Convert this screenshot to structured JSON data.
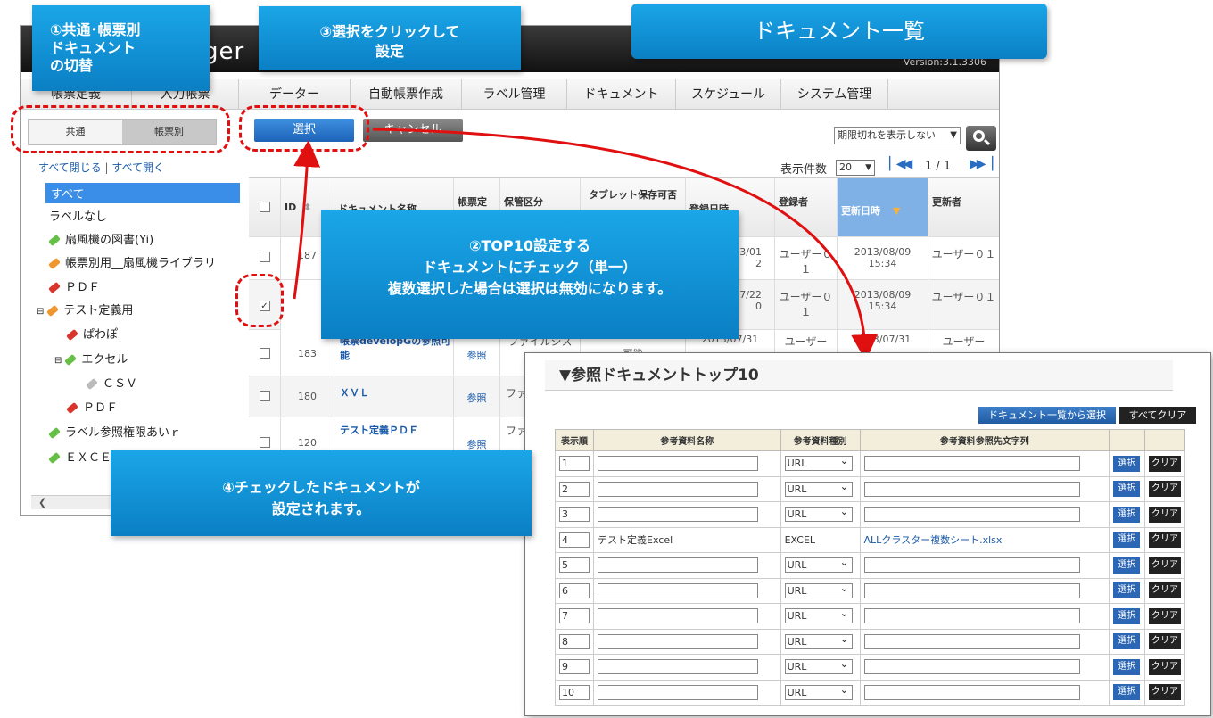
{
  "app": {
    "logo_text": "ger",
    "version": "Version:3.1.3306",
    "nav": [
      "帳票定義",
      "入力帳票",
      "データー",
      "自動帳票作成",
      "ラベル管理",
      "ドキュメント",
      "スケジュール",
      "システム管理"
    ],
    "segment": {
      "common": "共通",
      "form": "帳票別"
    },
    "tree_controls": {
      "close_all": "すべて閉じる",
      "sep": "|",
      "open_all": "すべて開く"
    },
    "tree": [
      {
        "label": "すべて",
        "tag": ""
      },
      {
        "label": "ラベルなし",
        "tag": ""
      },
      {
        "label": "扇風機の図書(Yi)",
        "tag": "green"
      },
      {
        "label": "帳票別用__扇風機ライブラリ",
        "tag": "orange"
      },
      {
        "label": "ＰＤＦ",
        "tag": "red"
      },
      {
        "label": "テスト定義用",
        "tag": "orange"
      },
      {
        "label": "ぱわぽ",
        "tag": "red"
      },
      {
        "label": "エクセル",
        "tag": "green"
      },
      {
        "label": "ＣＳＶ",
        "tag": "grey"
      },
      {
        "label": "ＰＤＦ",
        "tag": "red"
      },
      {
        "label": "ラベル参照権限あいｒ",
        "tag": "green"
      },
      {
        "label": "ＥＸＣＥ",
        "tag": "green"
      }
    ],
    "toolbar": {
      "select": "選択",
      "cancel": "キャンセル",
      "expire_filter": "期限切れを表示しない",
      "page_size_label": "表示件数",
      "page_size": "20",
      "page_info": "1 / 1"
    },
    "columns": [
      "ID",
      "ドキュメント名称",
      "帳票定",
      "保管区分",
      "タブレット保存可否",
      "登録日時",
      "登録者",
      "更新日時",
      "更新者"
    ],
    "rows": [
      {
        "id": "187",
        "name": "",
        "ref": "",
        "storage": "",
        "tablet": "",
        "reg_date": "3/01",
        "reg_time": "2",
        "registrant": "ユーザー０１",
        "upd_date": "2013/08/09",
        "upd_time": "15:34",
        "updater": "ユーザー０１",
        "checked": false
      },
      {
        "id": "",
        "name": "",
        "ref": "",
        "storage": "",
        "tablet": "",
        "reg_date": "7/22",
        "reg_time": "0",
        "registrant": "ユーザー０１",
        "upd_date": "2013/08/09",
        "upd_time": "15:34",
        "updater": "ユーザー０１",
        "checked": true
      },
      {
        "id": "183",
        "name": "帳票developGの参照可能",
        "ref": "参照",
        "storage": "ファイルシス",
        "tablet": "可能",
        "reg_date": "2013/07/31",
        "reg_time": "",
        "registrant": "ユーザー",
        "upd_date": "2013/07/31",
        "upd_time": "",
        "updater": "ユーザー",
        "checked": false
      },
      {
        "id": "180",
        "name": "ＸＶＬ",
        "ref": "参照",
        "storage": "ファ",
        "tablet": "",
        "reg_date": "",
        "reg_time": "",
        "registrant": "",
        "upd_date": "",
        "upd_time": "",
        "updater": "",
        "checked": false
      },
      {
        "id": "120",
        "name": "テスト定義ＰＤＦ",
        "ref": "参照",
        "storage": "ファ",
        "tablet": "",
        "reg_date": "",
        "reg_time": "",
        "registrant": "",
        "upd_date": "",
        "upd_time": "",
        "updater": "",
        "checked": false
      }
    ]
  },
  "callouts": {
    "c1": [
      "①共通･帳票別",
      "ドキュメント",
      "の切替"
    ],
    "c2": [
      "②TOP10設定する",
      "ドキュメントにチェック（単一）",
      "複数選択した場合は選択は無効になります。"
    ],
    "c3": [
      "③選択をクリックして",
      "設定"
    ],
    "c4": [
      "④チェックしたドキュメントが",
      "設定されます。"
    ],
    "title": "ドキュメント一覧"
  },
  "top10": {
    "title": "▼参照ドキュメントトップ10",
    "btn_from_list": "ドキュメント一覧から選択",
    "btn_clear_all": "すべてクリア",
    "headers": [
      "表示順",
      "参考資料名称",
      "参考資料種別",
      "参考資料参照先文字列",
      "",
      ""
    ],
    "select_label": "選択",
    "clear_label": "クリア",
    "rows": [
      {
        "order": "1",
        "name": "",
        "type": "URL",
        "ref": "",
        "filled": false
      },
      {
        "order": "2",
        "name": "",
        "type": "URL",
        "ref": "",
        "filled": false
      },
      {
        "order": "3",
        "name": "",
        "type": "URL",
        "ref": "",
        "filled": false
      },
      {
        "order": "4",
        "name": "テスト定義Excel",
        "type": "EXCEL",
        "ref": "ALLクラスター複数シート.xlsx",
        "filled": true
      },
      {
        "order": "5",
        "name": "",
        "type": "URL",
        "ref": "",
        "filled": false
      },
      {
        "order": "6",
        "name": "",
        "type": "URL",
        "ref": "",
        "filled": false
      },
      {
        "order": "7",
        "name": "",
        "type": "URL",
        "ref": "",
        "filled": false
      },
      {
        "order": "8",
        "name": "",
        "type": "URL",
        "ref": "",
        "filled": false
      },
      {
        "order": "9",
        "name": "",
        "type": "URL",
        "ref": "",
        "filled": false
      },
      {
        "order": "10",
        "name": "",
        "type": "URL",
        "ref": "",
        "filled": false
      }
    ]
  },
  "colors": {
    "accent": "#0b7fc4",
    "dash": "#e01010",
    "select_btn": "#1d64b8"
  }
}
